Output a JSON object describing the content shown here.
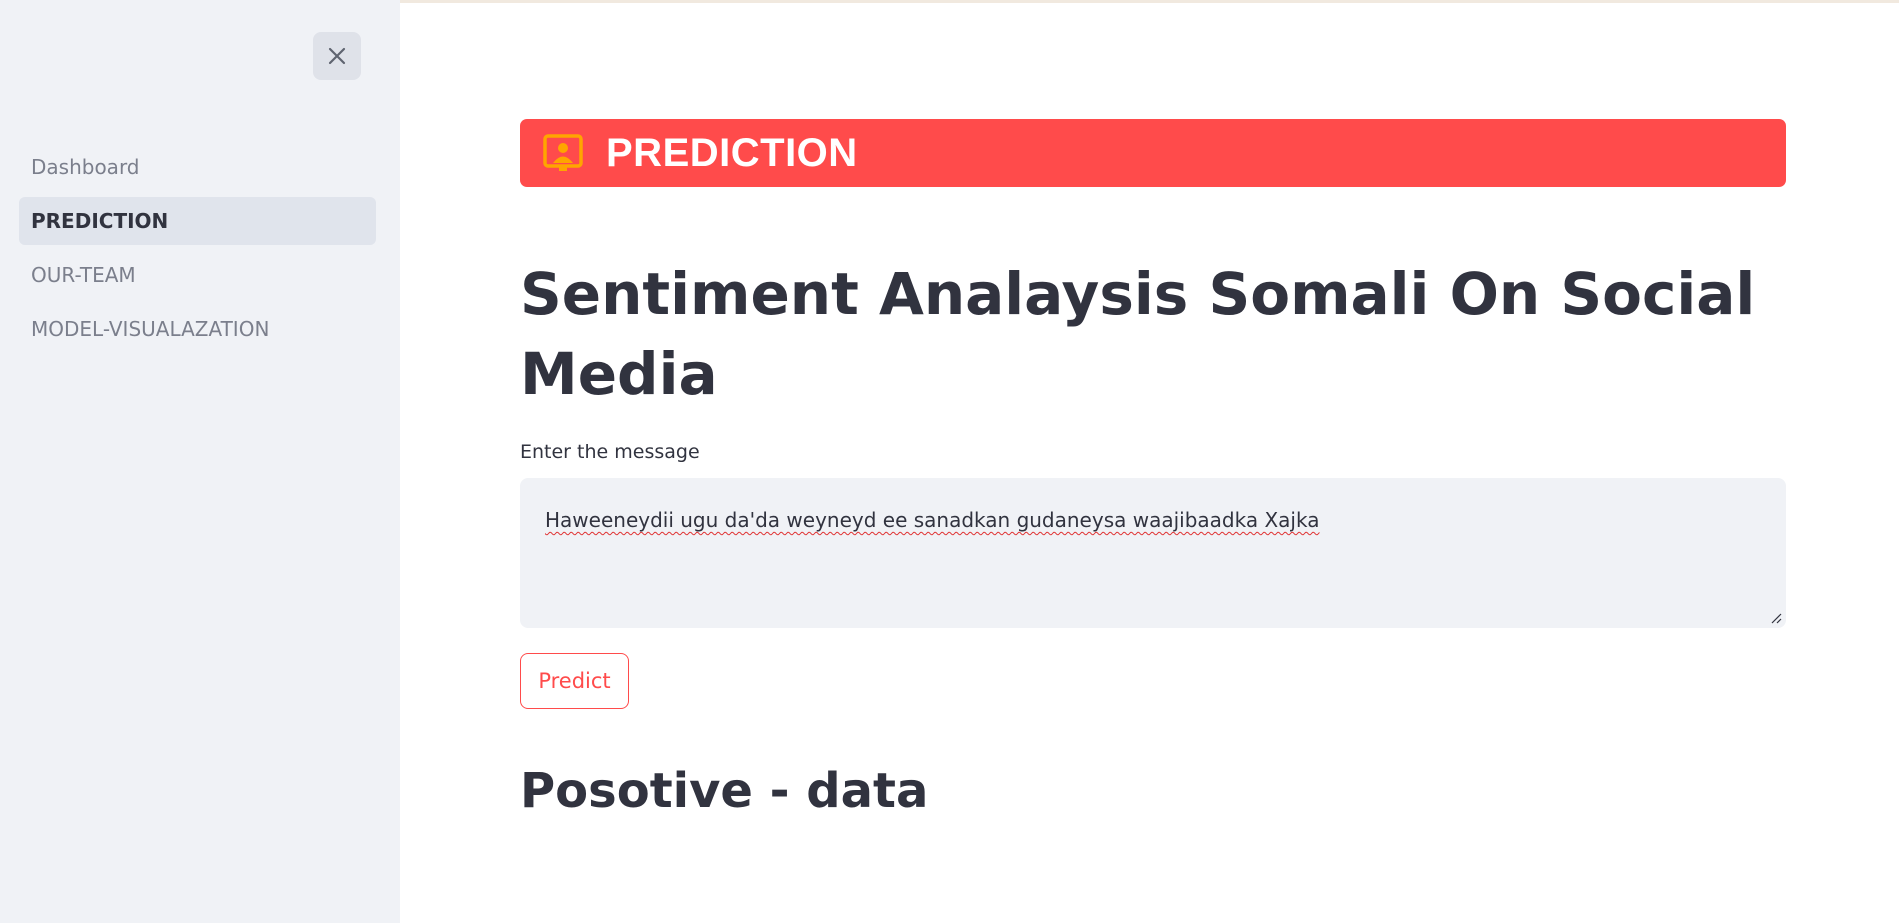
{
  "sidebar": {
    "close_icon": "close-icon",
    "items": [
      {
        "label": "Dashboard",
        "active": false
      },
      {
        "label": "PREDICTION",
        "active": true
      },
      {
        "label": "OUR-TEAM",
        "active": false
      },
      {
        "label": "MODEL-VISUALAZATION",
        "active": false
      }
    ]
  },
  "banner": {
    "icon": "presenter-icon",
    "title": "PREDICTION",
    "background": "#ff4b4b",
    "icon_color": "#ffa500"
  },
  "main": {
    "title": "Sentiment Analaysis Somali On Social Media",
    "input_label": "Enter the message",
    "input_value": "Haweeneydii ugu da'da weyneyd ee sanadkan gudaneysa waajibaadka Xajka",
    "predict_label": "Predict",
    "result": "Posotive - data"
  },
  "colors": {
    "accent": "#ff4b4b",
    "text": "#31333f",
    "sidebar_bg": "#f0f2f6"
  }
}
